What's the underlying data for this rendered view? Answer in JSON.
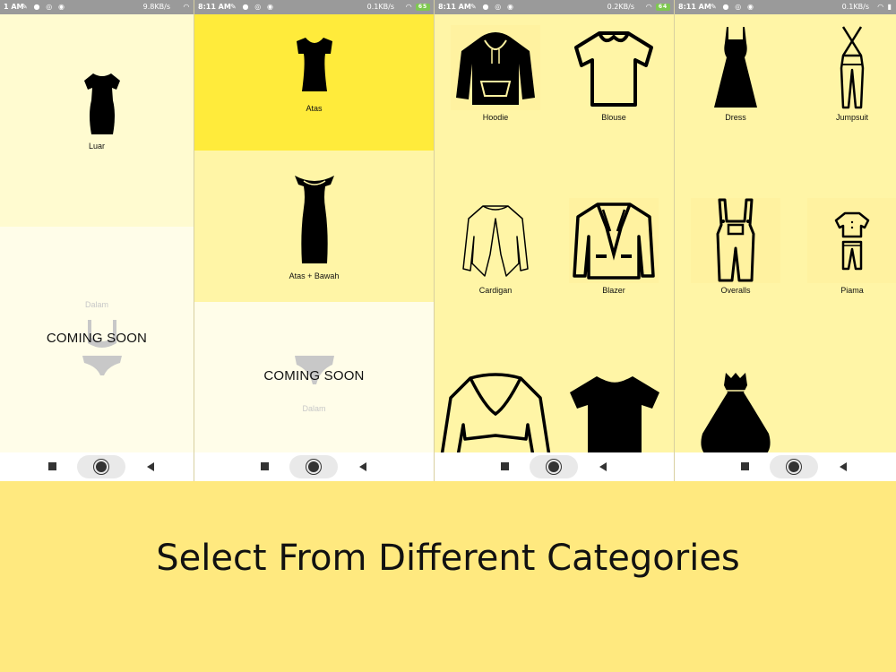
{
  "colors": {
    "background": "#ffe97f",
    "tile_light": "#fffbd0",
    "tile_mid": "#fff5a6",
    "tile_bright": "#ffeb3b",
    "tile_pale": "#fffde9"
  },
  "screens": [
    {
      "status": {
        "time": "1 AM",
        "speed": "9.8KB/s"
      },
      "tiles": [
        {
          "label": "Luar",
          "icon": "dress-silhouette-icon"
        },
        {
          "label": "Dalam",
          "icon": "underwear-icon",
          "overlay": "COMING SOON"
        }
      ]
    },
    {
      "status": {
        "time": "8:11 AM",
        "speed": "0.1KB/s",
        "battery": "65"
      },
      "tiles": [
        {
          "label": "Atas",
          "icon": "top-icon"
        },
        {
          "label": "Atas + Bawah",
          "icon": "long-dress-icon"
        },
        {
          "label": "Dalam",
          "icon": "underwear-icon",
          "overlay": "COMING SOON"
        }
      ]
    },
    {
      "status": {
        "time": "8:11 AM",
        "speed": "0.2KB/s",
        "battery": "64"
      },
      "items": [
        {
          "label": "Hoodie",
          "icon": "hoodie-icon"
        },
        {
          "label": "Blouse",
          "icon": "blouse-icon"
        },
        {
          "label": "Cardigan",
          "icon": "cardigan-icon"
        },
        {
          "label": "Blazer",
          "icon": "blazer-icon"
        },
        {
          "label": "",
          "icon": "bolero-icon"
        },
        {
          "label": "",
          "icon": "tshirt-icon"
        }
      ]
    },
    {
      "status": {
        "time": "8:11 AM",
        "speed": "0.1KB/s"
      },
      "items": [
        {
          "label": "Dress",
          "icon": "dress-icon"
        },
        {
          "label": "Jumpsuit",
          "icon": "jumpsuit-icon"
        },
        {
          "label": "Overalls",
          "icon": "overalls-icon"
        },
        {
          "label": "Piama",
          "icon": "pajama-icon"
        },
        {
          "label": "",
          "icon": "ball-gown-icon"
        }
      ]
    }
  ],
  "caption": "Select From Different Categories"
}
